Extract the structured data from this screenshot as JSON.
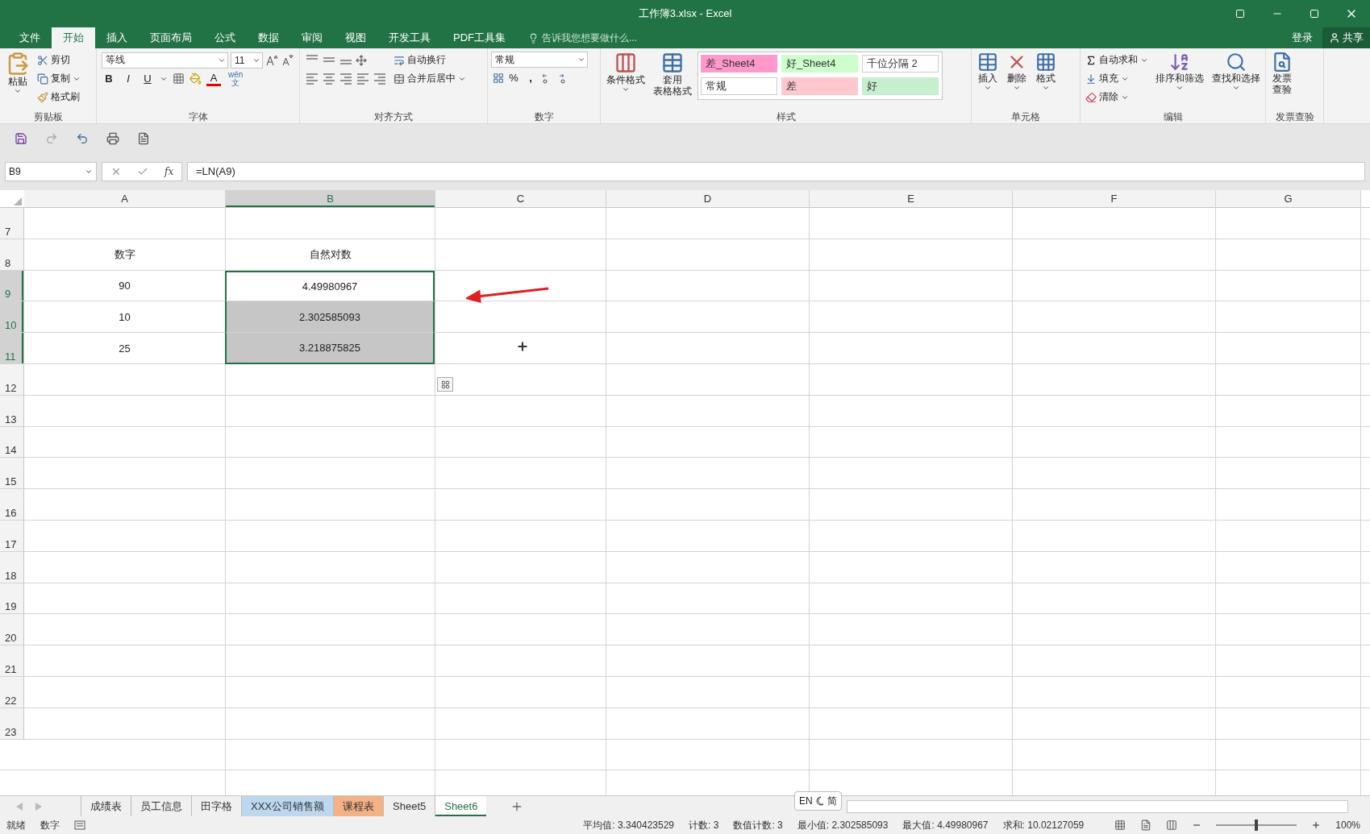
{
  "window": {
    "title": "工作簿3.xlsx - Excel"
  },
  "menu_tabs": [
    {
      "label": "文件",
      "selected": false
    },
    {
      "label": "开始",
      "selected": true
    },
    {
      "label": "插入",
      "selected": false
    },
    {
      "label": "页面布局",
      "selected": false
    },
    {
      "label": "公式",
      "selected": false
    },
    {
      "label": "数据",
      "selected": false
    },
    {
      "label": "审阅",
      "selected": false
    },
    {
      "label": "视图",
      "selected": false
    },
    {
      "label": "开发工具",
      "selected": false
    },
    {
      "label": "PDF工具集",
      "selected": false
    }
  ],
  "tell_me": "告诉我您想要做什么...",
  "account": "登录",
  "share": "共享",
  "ribbon": {
    "clipboard": {
      "paste": "粘贴",
      "cut": "剪切",
      "copy": "复制",
      "format_painter": "格式刷",
      "label": "剪贴板"
    },
    "font": {
      "font_name": "等线",
      "font_size": "11",
      "bold": "B",
      "italic": "I",
      "underline": "U",
      "font_color": "A",
      "phonetic_top": "wén",
      "phonetic_bottom": "文",
      "label": "字体"
    },
    "alignment": {
      "wrap": "自动换行",
      "merge": "合并后居中",
      "label": "对齐方式"
    },
    "number": {
      "format": "常规",
      "percent": "%",
      "comma": ",",
      "label": "数字"
    },
    "styles": {
      "conditional": "条件格式",
      "table_top": "套用",
      "table_bottom": "表格格式",
      "label": "样式",
      "gallery": [
        {
          "label": "差_Sheet4",
          "color": "#ff99cc"
        },
        {
          "label": "好_Sheet4",
          "color": "#ccffcc"
        },
        {
          "label": "千位分隔 2",
          "color": "#ffffff"
        },
        {
          "label": "常规",
          "color": "#ffffff"
        },
        {
          "label": "差",
          "color": "#ffc7ce"
        },
        {
          "label": "好",
          "color": "#c6efce"
        }
      ]
    },
    "cells": {
      "insert": "插入",
      "delete": "删除",
      "format": "格式",
      "label": "单元格"
    },
    "editing": {
      "autosum": "自动求和",
      "fill": "填充",
      "clear": "清除",
      "sort": "排序和筛选",
      "find": "查找和选择",
      "label": "编辑"
    },
    "invoice": {
      "button_top": "发票",
      "button_bottom": "查验",
      "label": "发票查验"
    }
  },
  "formula_bar": {
    "name_box": "B9",
    "fx": "fx",
    "formula": "=LN(A9)"
  },
  "sheet": {
    "columns": [
      {
        "label": "A",
        "selected": false
      },
      {
        "label": "B",
        "selected": true
      },
      {
        "label": "C",
        "selected": false
      },
      {
        "label": "D",
        "selected": false
      },
      {
        "label": "E",
        "selected": false
      },
      {
        "label": "F",
        "selected": false
      },
      {
        "label": "G",
        "selected": false
      }
    ],
    "rows": [
      {
        "number": "7",
        "selected": false
      },
      {
        "number": "8",
        "selected": false,
        "cells": [
          {
            "text": "数字",
            "selected": false,
            "active": false
          },
          {
            "text": "自然对数",
            "selected": false,
            "active": false
          }
        ]
      },
      {
        "number": "9",
        "selected": true,
        "cells": [
          {
            "text": "90",
            "selected": false,
            "active": false
          },
          {
            "text": "4.49980967",
            "selected": true,
            "active": true
          }
        ]
      },
      {
        "number": "10",
        "selected": true,
        "cells": [
          {
            "text": "10",
            "selected": false,
            "active": false
          },
          {
            "text": "2.302585093",
            "selected": true,
            "active": false
          }
        ]
      },
      {
        "number": "11",
        "selected": true,
        "cells": [
          {
            "text": "25",
            "selected": false,
            "active": false
          },
          {
            "text": "3.218875825",
            "selected": true,
            "active": false
          }
        ]
      },
      {
        "number": "12",
        "selected": false
      },
      {
        "number": "13",
        "selected": false
      },
      {
        "number": "14",
        "selected": false
      },
      {
        "number": "15",
        "selected": false
      },
      {
        "number": "16",
        "selected": false
      },
      {
        "number": "17",
        "selected": false
      },
      {
        "number": "18",
        "selected": false
      },
      {
        "number": "19",
        "selected": false
      },
      {
        "number": "20",
        "selected": false
      },
      {
        "number": "21",
        "selected": false
      },
      {
        "number": "22",
        "selected": false
      },
      {
        "number": "23",
        "selected": false
      }
    ]
  },
  "sheet_tabs": [
    {
      "label": "成绩表",
      "selected": false
    },
    {
      "label": "员工信息",
      "selected": false
    },
    {
      "label": "田字格",
      "selected": false
    },
    {
      "label": "XXX公司销售额",
      "selected": false,
      "color": "#bdd7ee"
    },
    {
      "label": "课程表",
      "selected": false,
      "color": "#f4b183"
    },
    {
      "label": "Sheet5",
      "selected": false
    },
    {
      "label": "Sheet6",
      "selected": true
    }
  ],
  "ime": {
    "mode": "EN",
    "script": "简"
  },
  "status_bar": {
    "left": [
      "就绪",
      "数字"
    ],
    "stats": [
      "平均值: 3.340423529",
      "计数: 3",
      "数值计数: 3",
      "最小值: 2.302585093",
      "最大值: 4.49980967",
      "求和: 10.02127059"
    ],
    "zoom": {
      "level": 0.5,
      "reading": "100%"
    }
  }
}
